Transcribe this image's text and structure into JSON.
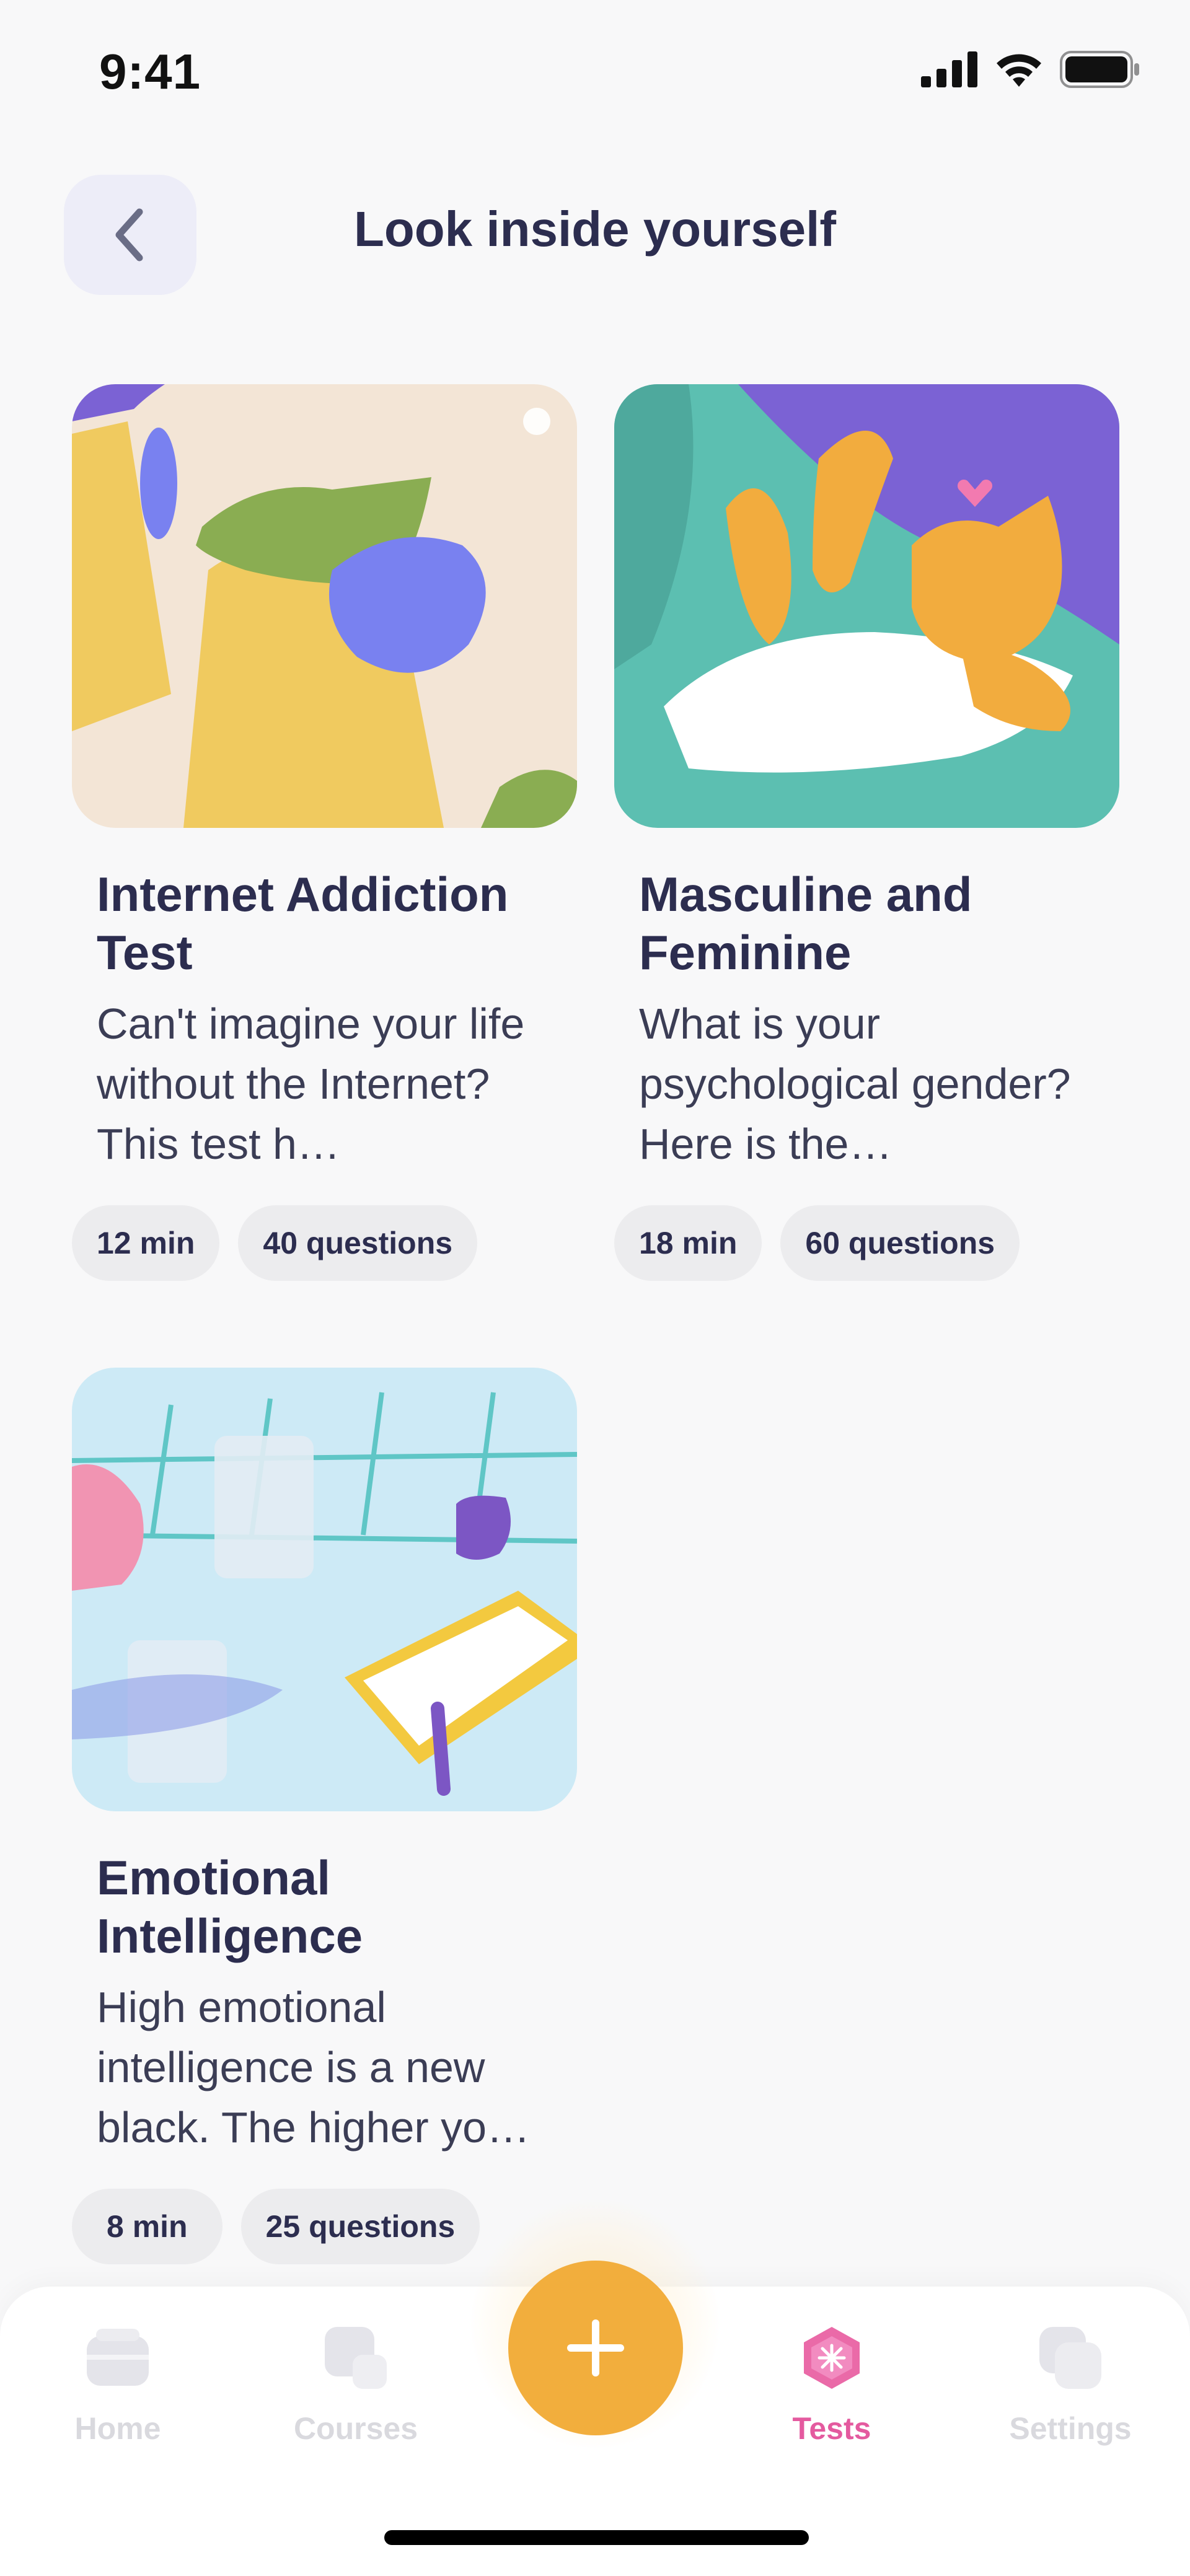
{
  "status_bar": {
    "time": "9:41"
  },
  "header": {
    "title": "Look inside yourself",
    "back_icon": "chevron-left-icon"
  },
  "tests": [
    {
      "title": "Internet Addiction Test",
      "description": "Can't imagine your life without the Internet? This test h…",
      "duration": "12 min",
      "questions": "40 questions",
      "colors": {
        "bg": "#f3e5d6",
        "accent": "#f0ca5f",
        "figure": "#8aad52",
        "scarf": "#7981f0"
      }
    },
    {
      "title": "Masculine and Feminine",
      "description": "What is your psychological gender? Here is the…",
      "duration": "18 min",
      "questions": "60 questions",
      "colors": {
        "bg": "#5cbfb1",
        "accent": "#7b62d4",
        "cat": "#f2ac3e",
        "cloth": "#ffffff"
      }
    },
    {
      "title": "Emotional Intelligence",
      "description": "High emotional intelligence is a new black. The higher yo…",
      "duration": "8 min",
      "questions": "25 questions",
      "colors": {
        "bg": "#cdeaf6",
        "accent": "#f3c93f",
        "cup": "#7c56c4",
        "brain": "#f194b2"
      }
    }
  ],
  "tab_bar": {
    "fab_icon": "plus-icon",
    "items": [
      {
        "label": "Home",
        "icon": "home-icon",
        "active": false
      },
      {
        "label": "Courses",
        "icon": "courses-icon",
        "active": false
      },
      {
        "label": "Tests",
        "icon": "tests-icon",
        "active": true
      },
      {
        "label": "Settings",
        "icon": "settings-icon",
        "active": false
      }
    ]
  },
  "colors": {
    "accent": "#f2ae3d",
    "active_tab": "#e45a9f",
    "text": "#2c2d4f",
    "background": "#f8f8f9"
  }
}
